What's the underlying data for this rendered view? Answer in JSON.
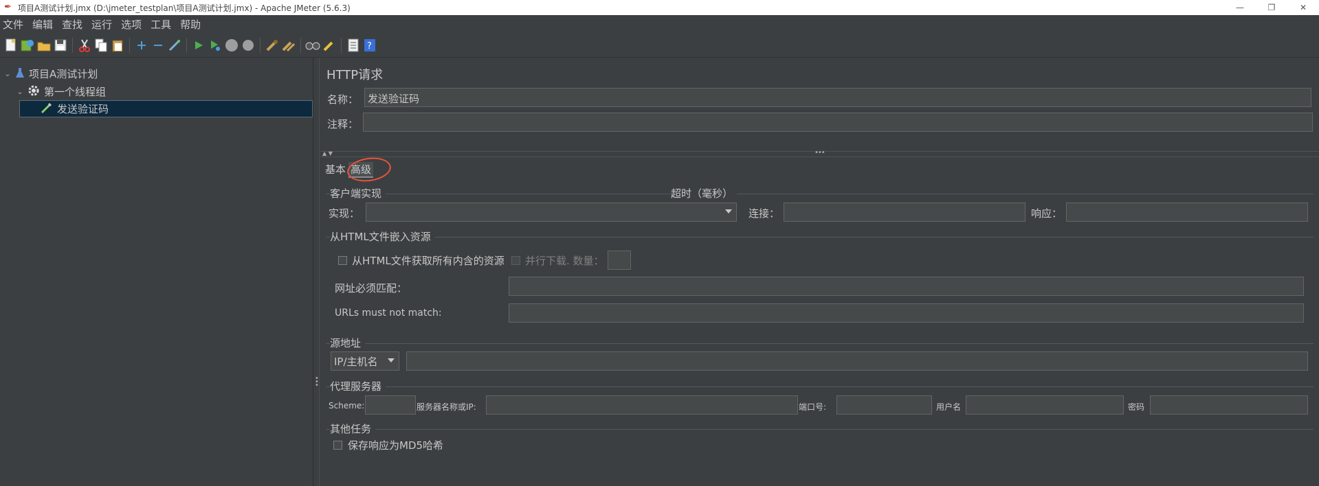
{
  "window": {
    "title": "项目A测试计划.jmx (D:\\jmeter_testplan\\项目A测试计划.jmx) - Apache JMeter (5.6.3)",
    "minimize": "—",
    "maximize": "❐",
    "close": "✕"
  },
  "menu": [
    "文件",
    "编辑",
    "查找",
    "运行",
    "选项",
    "工具",
    "帮助"
  ],
  "toolbar": {
    "icons": [
      "new-icon",
      "templates-icon",
      "open-icon",
      "save-icon",
      "cut-icon",
      "copy-icon",
      "paste-icon",
      "expand-icon",
      "collapse-icon",
      "toggle-icon",
      "start-icon",
      "start-no-pause-icon",
      "stop-icon",
      "shutdown-icon",
      "clear-icon",
      "clear-all-icon",
      "search-icon",
      "reset-search-icon",
      "function-helper-icon",
      "help-icon"
    ]
  },
  "tree": {
    "test_plan": "项目A测试计划",
    "thread_group": "第一个线程组",
    "sampler": "发送验证码"
  },
  "panel": {
    "title": "HTTP请求",
    "name_label": "名称：",
    "name_value": "发送验证码",
    "comment_label": "注释：",
    "comment_value": ""
  },
  "tabs": {
    "basic": "基本",
    "advanced": "高级"
  },
  "client": {
    "group_title": "客户端实现",
    "impl_label": "实现：",
    "impl_value": ""
  },
  "timeout": {
    "group_title": "超时（毫秒）",
    "connect_label": "连接：",
    "connect_value": "",
    "response_label": "响应：",
    "response_value": ""
  },
  "embedded": {
    "group_title": "从HTML文件嵌入资源",
    "retrieve_label": "从HTML文件获取所有内含的资源",
    "retrieve_checked": false,
    "parallel_label": "并行下载. 数量：",
    "parallel_checked": false,
    "parallel_value": "",
    "must_match_label": "网址必须匹配：",
    "must_match_value": "",
    "must_not_match_label": "URLs must not match:",
    "must_not_match_value": ""
  },
  "source": {
    "group_title": "源地址",
    "type_value": "IP/主机名",
    "address_value": ""
  },
  "proxy": {
    "group_title": "代理服务器",
    "scheme_label": "Scheme:",
    "scheme_value": "",
    "server_label": "服务器名称或IP:",
    "server_value": "",
    "port_label": "端口号:",
    "port_value": "",
    "user_label": "用户名",
    "user_value": "",
    "password_label": "密码",
    "password_value": ""
  },
  "other": {
    "group_title": "其他任务",
    "md5_label": "保存响应为MD5哈希",
    "md5_checked": false
  }
}
